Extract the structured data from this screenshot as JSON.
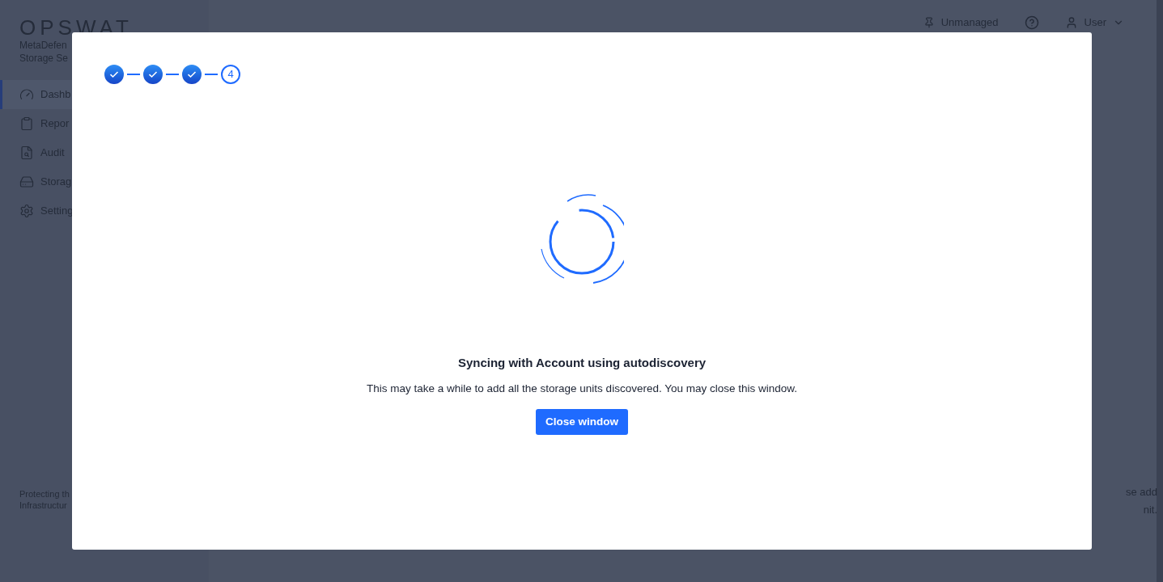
{
  "brand": {
    "logo": "OPSWAT",
    "product_lines": [
      "MetaDefen",
      "Storage Se"
    ]
  },
  "sidebar": {
    "items": [
      {
        "label": "Dashb",
        "selected": true
      },
      {
        "label": "Repor",
        "selected": false
      },
      {
        "label": "Audit",
        "selected": false
      },
      {
        "label": "Storag",
        "selected": false
      },
      {
        "label": "Setting",
        "selected": false
      }
    ],
    "footer": [
      "Protecting th",
      "Infrastructur"
    ]
  },
  "header": {
    "mode": "Unmanaged",
    "user": "User"
  },
  "background_text": [
    "se add",
    "nit."
  ],
  "dialog": {
    "steps": [
      {
        "completed": true
      },
      {
        "completed": true
      },
      {
        "completed": true
      },
      {
        "completed": false,
        "label": "4"
      }
    ],
    "title": "Syncing with Account using autodiscovery",
    "message": "This may take a while to add all the storage units discovered. You may close this window.",
    "button": "Close window"
  }
}
